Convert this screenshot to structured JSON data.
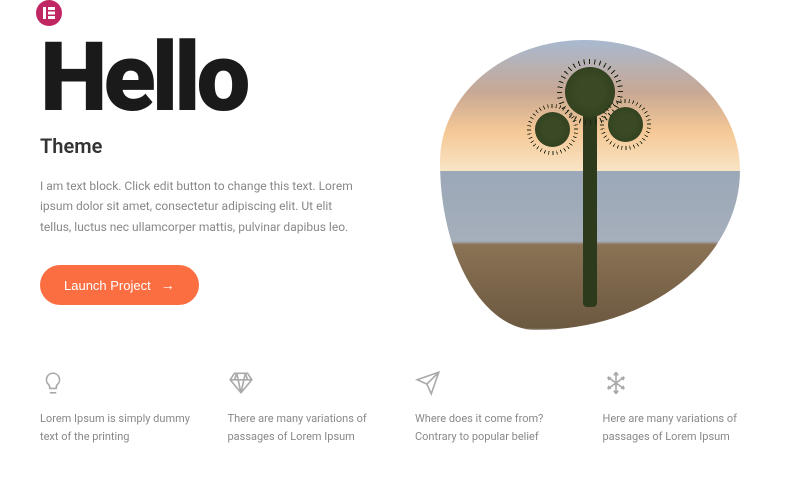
{
  "brand": {
    "color": "#c02662"
  },
  "hero": {
    "title": "Hello",
    "subtitle": "Theme",
    "body": "I am text block. Click edit button to change this text. Lorem ipsum dolor sit amet, consectetur adipiscing elit. Ut elit tellus, luctus nec ullamcorper mattis, pulvinar dapibus leo.",
    "cta_label": "Launch Project",
    "cta_color": "#fa6e42"
  },
  "features": [
    {
      "icon": "lightbulb-icon",
      "text": "Lorem Ipsum is simply dummy text of the printing"
    },
    {
      "icon": "diamond-icon",
      "text": "There are many variations of passages of Lorem Ipsum"
    },
    {
      "icon": "paper-plane-icon",
      "text": "Where does it come from? Contrary to popular belief"
    },
    {
      "icon": "snowflake-icon",
      "text": "Here are many variations of passages of Lorem Ipsum"
    }
  ]
}
